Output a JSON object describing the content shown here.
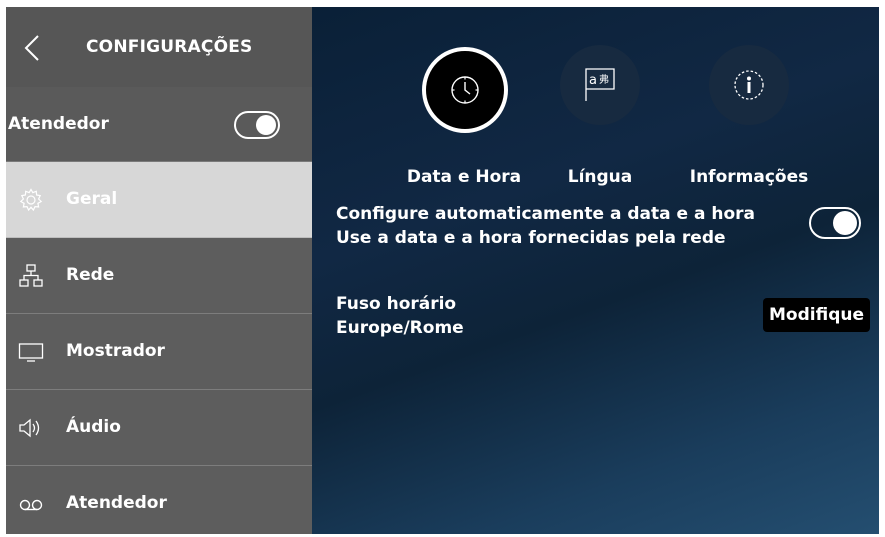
{
  "colors": {
    "sidebar_bg": "#5c5c5c",
    "active_item_bg": "#d7d7d7",
    "main_bg": "#0e1d33",
    "text": "#ffffff"
  },
  "sidebar": {
    "title": "CONFIGURAÇÕES",
    "answering_machine": {
      "label": "Atendedor",
      "toggle_on": true
    },
    "items": [
      {
        "label": "Geral",
        "icon": "gear-icon",
        "active": true
      },
      {
        "label": "Rede",
        "icon": "network-icon",
        "active": false
      },
      {
        "label": "Mostrador",
        "icon": "monitor-icon",
        "active": false
      },
      {
        "label": "Áudio",
        "icon": "speaker-icon",
        "active": false
      },
      {
        "label": "Atendedor",
        "icon": "voicemail-icon",
        "active": false
      }
    ]
  },
  "tabs": [
    {
      "label": "Data e Hora",
      "icon": "clock-icon",
      "active": true
    },
    {
      "label": "Língua",
      "icon": "language-icon",
      "active": false
    },
    {
      "label": "Informações",
      "icon": "info-icon",
      "active": false
    }
  ],
  "auto_datetime": {
    "line1": "Configure automaticamente a data e a hora",
    "line2": "Use a data e a hora fornecidas pela rede",
    "toggle_on": true
  },
  "timezone": {
    "label": "Fuso horário",
    "value": "Europe/Rome",
    "button_label": "Modifique"
  }
}
